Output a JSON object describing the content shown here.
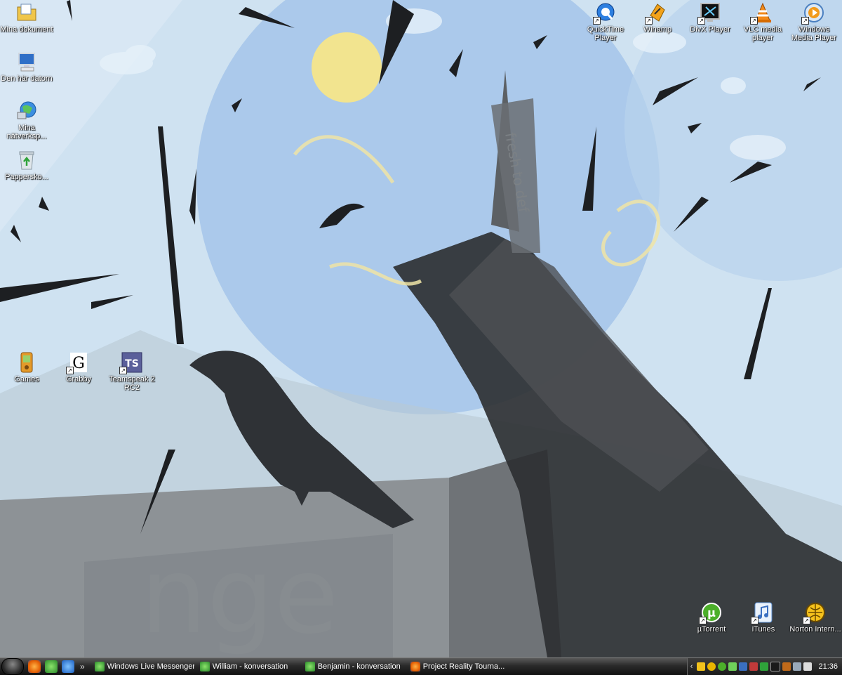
{
  "desktop": {
    "left_icons": [
      {
        "label": "Mina dokument",
        "icon": "folder-documents-icon"
      },
      {
        "label": "Den här datorn",
        "icon": "computer-icon"
      },
      {
        "label": "Mina nätverksp...",
        "icon": "network-places-icon"
      },
      {
        "label": "Papperskо...",
        "icon": "recycle-bin-icon"
      }
    ],
    "middle_icons": [
      {
        "label": "Games",
        "icon": "games-icon"
      },
      {
        "label": "Grabby",
        "icon": "grabby-icon"
      },
      {
        "label": "Teamspeak 2 RC2",
        "icon": "teamspeak-icon"
      }
    ],
    "top_right_icons": [
      {
        "label": "QuickTime Player",
        "icon": "quicktime-icon"
      },
      {
        "label": "Winamp",
        "icon": "winamp-icon"
      },
      {
        "label": "DivX Player",
        "icon": "divx-icon"
      },
      {
        "label": "VLC media player",
        "icon": "vlc-icon"
      },
      {
        "label": "Windows Media Player",
        "icon": "windows-media-player-icon"
      }
    ],
    "bottom_right_icons": [
      {
        "label": "µTorrent",
        "icon": "utorrent-icon"
      },
      {
        "label": "iTunes",
        "icon": "itunes-icon"
      },
      {
        "label": "Norton Intern...",
        "icon": "norton-icon"
      }
    ],
    "wallpaper_text": {
      "vertical": "fresh to def",
      "large": "nge"
    }
  },
  "taskbar": {
    "quick_launch": [
      "firefox-icon",
      "messenger-icon",
      "ie-icon"
    ],
    "quick_launch_more": "»",
    "tasks": [
      {
        "label": "Windows Live Messenger",
        "icon": "messenger-icon"
      },
      {
        "label": "William - konversation",
        "icon": "messenger-icon"
      },
      {
        "label": "Benjamin - konversation",
        "icon": "messenger-icon"
      },
      {
        "label": "Project Reality Tourna...",
        "icon": "firefox-icon"
      }
    ],
    "tray_expand": "‹",
    "clock": "21:36"
  },
  "colors": {
    "sky": "#c9dff0",
    "sky_circle": "#a8c9ea",
    "sun": "#f2e48f",
    "ink": "#2b2d30",
    "ground": "#8e9396"
  }
}
